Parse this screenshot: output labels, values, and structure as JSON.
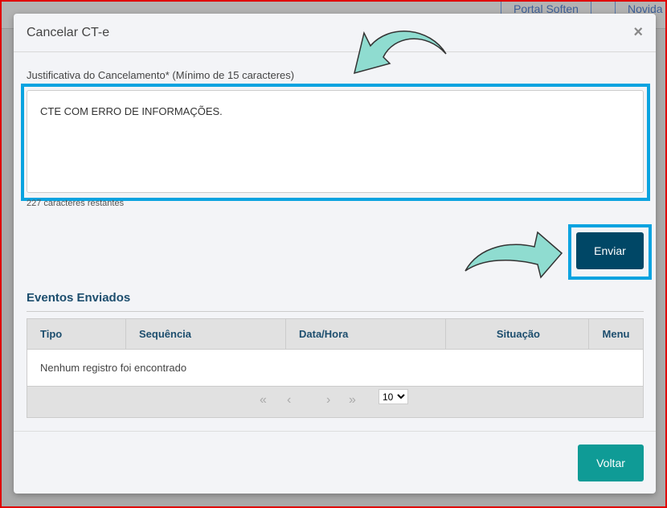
{
  "background": {
    "links": [
      "Portal Soften",
      "Novida"
    ]
  },
  "modal": {
    "title": "Cancelar CT-e",
    "close_label": "×",
    "justification_label": "Justificativa do Cancelamento* (Mínimo de 15 caracteres)",
    "justification_value": "CTE COM ERRO DE INFORMAÇÕES.",
    "remaining": "227 caracteres restantes",
    "send_label": "Enviar",
    "events_title": "Eventos Enviados",
    "table": {
      "columns": [
        "Tipo",
        "Sequência",
        "Data/Hora",
        "Situação",
        "Menu"
      ],
      "empty": "Nenhum registro foi encontrado"
    },
    "pager": {
      "first": "«",
      "prev": "‹",
      "next": "›",
      "last": "»",
      "page_size": "10"
    },
    "back_label": "Voltar"
  },
  "colors": {
    "highlight": "#0aa3e0",
    "send": "#004766",
    "back": "#0f9b96",
    "arrow": "#8fdcd0"
  }
}
